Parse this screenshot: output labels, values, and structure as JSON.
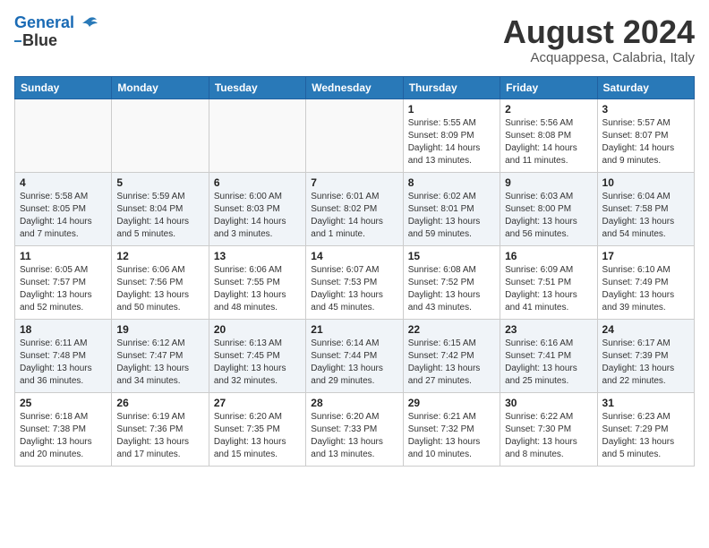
{
  "header": {
    "logo_line1": "General",
    "logo_line2": "Blue",
    "month_year": "August 2024",
    "location": "Acquappesa, Calabria, Italy"
  },
  "weekdays": [
    "Sunday",
    "Monday",
    "Tuesday",
    "Wednesday",
    "Thursday",
    "Friday",
    "Saturday"
  ],
  "weeks": [
    [
      {
        "day": "",
        "info": ""
      },
      {
        "day": "",
        "info": ""
      },
      {
        "day": "",
        "info": ""
      },
      {
        "day": "",
        "info": ""
      },
      {
        "day": "1",
        "info": "Sunrise: 5:55 AM\nSunset: 8:09 PM\nDaylight: 14 hours\nand 13 minutes."
      },
      {
        "day": "2",
        "info": "Sunrise: 5:56 AM\nSunset: 8:08 PM\nDaylight: 14 hours\nand 11 minutes."
      },
      {
        "day": "3",
        "info": "Sunrise: 5:57 AM\nSunset: 8:07 PM\nDaylight: 14 hours\nand 9 minutes."
      }
    ],
    [
      {
        "day": "4",
        "info": "Sunrise: 5:58 AM\nSunset: 8:05 PM\nDaylight: 14 hours\nand 7 minutes."
      },
      {
        "day": "5",
        "info": "Sunrise: 5:59 AM\nSunset: 8:04 PM\nDaylight: 14 hours\nand 5 minutes."
      },
      {
        "day": "6",
        "info": "Sunrise: 6:00 AM\nSunset: 8:03 PM\nDaylight: 14 hours\nand 3 minutes."
      },
      {
        "day": "7",
        "info": "Sunrise: 6:01 AM\nSunset: 8:02 PM\nDaylight: 14 hours\nand 1 minute."
      },
      {
        "day": "8",
        "info": "Sunrise: 6:02 AM\nSunset: 8:01 PM\nDaylight: 13 hours\nand 59 minutes."
      },
      {
        "day": "9",
        "info": "Sunrise: 6:03 AM\nSunset: 8:00 PM\nDaylight: 13 hours\nand 56 minutes."
      },
      {
        "day": "10",
        "info": "Sunrise: 6:04 AM\nSunset: 7:58 PM\nDaylight: 13 hours\nand 54 minutes."
      }
    ],
    [
      {
        "day": "11",
        "info": "Sunrise: 6:05 AM\nSunset: 7:57 PM\nDaylight: 13 hours\nand 52 minutes."
      },
      {
        "day": "12",
        "info": "Sunrise: 6:06 AM\nSunset: 7:56 PM\nDaylight: 13 hours\nand 50 minutes."
      },
      {
        "day": "13",
        "info": "Sunrise: 6:06 AM\nSunset: 7:55 PM\nDaylight: 13 hours\nand 48 minutes."
      },
      {
        "day": "14",
        "info": "Sunrise: 6:07 AM\nSunset: 7:53 PM\nDaylight: 13 hours\nand 45 minutes."
      },
      {
        "day": "15",
        "info": "Sunrise: 6:08 AM\nSunset: 7:52 PM\nDaylight: 13 hours\nand 43 minutes."
      },
      {
        "day": "16",
        "info": "Sunrise: 6:09 AM\nSunset: 7:51 PM\nDaylight: 13 hours\nand 41 minutes."
      },
      {
        "day": "17",
        "info": "Sunrise: 6:10 AM\nSunset: 7:49 PM\nDaylight: 13 hours\nand 39 minutes."
      }
    ],
    [
      {
        "day": "18",
        "info": "Sunrise: 6:11 AM\nSunset: 7:48 PM\nDaylight: 13 hours\nand 36 minutes."
      },
      {
        "day": "19",
        "info": "Sunrise: 6:12 AM\nSunset: 7:47 PM\nDaylight: 13 hours\nand 34 minutes."
      },
      {
        "day": "20",
        "info": "Sunrise: 6:13 AM\nSunset: 7:45 PM\nDaylight: 13 hours\nand 32 minutes."
      },
      {
        "day": "21",
        "info": "Sunrise: 6:14 AM\nSunset: 7:44 PM\nDaylight: 13 hours\nand 29 minutes."
      },
      {
        "day": "22",
        "info": "Sunrise: 6:15 AM\nSunset: 7:42 PM\nDaylight: 13 hours\nand 27 minutes."
      },
      {
        "day": "23",
        "info": "Sunrise: 6:16 AM\nSunset: 7:41 PM\nDaylight: 13 hours\nand 25 minutes."
      },
      {
        "day": "24",
        "info": "Sunrise: 6:17 AM\nSunset: 7:39 PM\nDaylight: 13 hours\nand 22 minutes."
      }
    ],
    [
      {
        "day": "25",
        "info": "Sunrise: 6:18 AM\nSunset: 7:38 PM\nDaylight: 13 hours\nand 20 minutes."
      },
      {
        "day": "26",
        "info": "Sunrise: 6:19 AM\nSunset: 7:36 PM\nDaylight: 13 hours\nand 17 minutes."
      },
      {
        "day": "27",
        "info": "Sunrise: 6:20 AM\nSunset: 7:35 PM\nDaylight: 13 hours\nand 15 minutes."
      },
      {
        "day": "28",
        "info": "Sunrise: 6:20 AM\nSunset: 7:33 PM\nDaylight: 13 hours\nand 13 minutes."
      },
      {
        "day": "29",
        "info": "Sunrise: 6:21 AM\nSunset: 7:32 PM\nDaylight: 13 hours\nand 10 minutes."
      },
      {
        "day": "30",
        "info": "Sunrise: 6:22 AM\nSunset: 7:30 PM\nDaylight: 13 hours\nand 8 minutes."
      },
      {
        "day": "31",
        "info": "Sunrise: 6:23 AM\nSunset: 7:29 PM\nDaylight: 13 hours\nand 5 minutes."
      }
    ]
  ]
}
